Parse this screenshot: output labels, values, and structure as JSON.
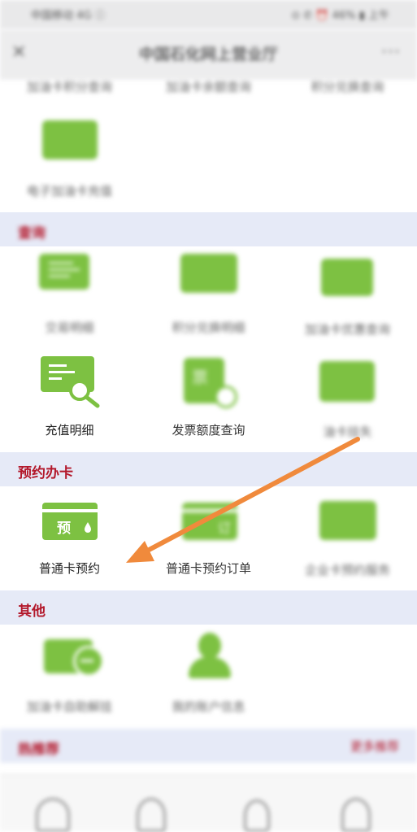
{
  "status_bar": {
    "left_text": "中国移动 4G ⓘ",
    "right_text": "⊙ ✆ ⏰ 46% ▮ 上午"
  },
  "header": {
    "title": "中国石化网上营业厅",
    "back_icon": "back-icon",
    "more_icon": "more-icon"
  },
  "top_partial_labels": [
    "加油卡积分查询",
    "加油卡余额查询",
    "积分兑换查询"
  ],
  "top_row2_label": "电子加油卡充值",
  "sections": {
    "query": {
      "title": "查询"
    },
    "booking": {
      "title": "预约办卡"
    },
    "other": {
      "title": "其他"
    },
    "recommend": {
      "title": "热推荐",
      "more": "更多推荐"
    }
  },
  "query_tiles": [
    {
      "label": "交易明细",
      "icon": "transaction-detail-icon"
    },
    {
      "label": "积分兑换明细",
      "icon": "card-icon"
    },
    {
      "label": "加油卡优惠查询",
      "icon": "discount-icon"
    },
    {
      "label": "充值明细",
      "icon": "recharge-detail-icon"
    },
    {
      "label": "发票额度查询",
      "icon": "invoice-quota-icon"
    },
    {
      "label": "油卡挂失",
      "icon": "card-loss-icon"
    }
  ],
  "booking_tiles": [
    {
      "label": "普通卡预约",
      "icon": "regular-card-booking-icon",
      "badge": "预"
    },
    {
      "label": "普通卡预约订单",
      "icon": "booking-order-icon",
      "badge": "订"
    },
    {
      "label": "企业卡预约服务",
      "icon": "company-card-icon"
    }
  ],
  "other_tiles": [
    {
      "label": "加油卡自助解挂",
      "icon": "card-unlock-icon"
    },
    {
      "label": "我的账户信息",
      "icon": "user-account-icon"
    }
  ],
  "tab_bar": [
    "home-icon",
    "user-icon",
    "fuel-icon",
    "profile-icon"
  ],
  "colors": {
    "green": "#7dc142",
    "section_red": "#b3182b",
    "section_bg": "#e6eaf7",
    "arrow": "#f08a3c"
  }
}
